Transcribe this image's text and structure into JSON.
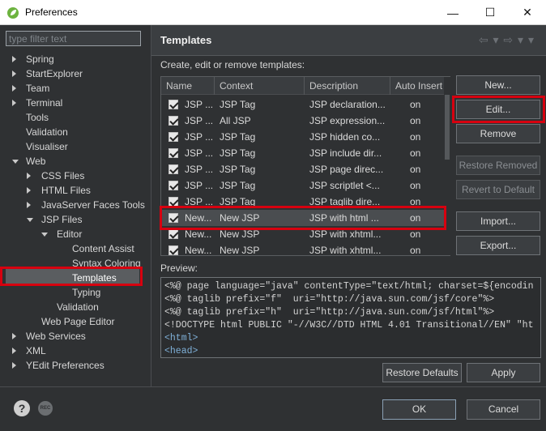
{
  "window": {
    "title": "Preferences",
    "minimize": "—",
    "maximize": "☐",
    "close": "✕"
  },
  "filter": {
    "placeholder": "type filter text"
  },
  "tree": [
    {
      "label": "Spring",
      "expand": "closed"
    },
    {
      "label": "StartExplorer",
      "expand": "closed"
    },
    {
      "label": "Team",
      "expand": "closed"
    },
    {
      "label": "Terminal",
      "expand": "closed"
    },
    {
      "label": "Tools",
      "expand": "none"
    },
    {
      "label": "Validation",
      "expand": "none"
    },
    {
      "label": "Visualiser",
      "expand": "none"
    },
    {
      "label": "Web",
      "expand": "open"
    },
    {
      "label": "CSS Files",
      "expand": "closed"
    },
    {
      "label": "HTML Files",
      "expand": "closed"
    },
    {
      "label": "JavaServer Faces Tools",
      "expand": "closed"
    },
    {
      "label": "JSP Files",
      "expand": "open"
    },
    {
      "label": "Editor",
      "expand": "open"
    },
    {
      "label": "Content Assist",
      "expand": "none"
    },
    {
      "label": "Syntax Coloring",
      "expand": "none"
    },
    {
      "label": "Templates",
      "expand": "none",
      "selected": true
    },
    {
      "label": "Typing",
      "expand": "none"
    },
    {
      "label": "Validation",
      "expand": "none"
    },
    {
      "label": "Web Page Editor",
      "expand": "none"
    },
    {
      "label": "Web Services",
      "expand": "closed"
    },
    {
      "label": "XML",
      "expand": "closed"
    },
    {
      "label": "YEdit Preferences",
      "expand": "closed"
    }
  ],
  "page": {
    "title": "Templates",
    "description": "Create, edit or remove templates:",
    "nav_arrows": "⇦ ▾ ⇨ ▾ ▾"
  },
  "table": {
    "columns": [
      "Name",
      "Context",
      "Description",
      "Auto Insert"
    ],
    "rows": [
      {
        "name": "JSP ...",
        "context": "JSP Tag",
        "description": "JSP declaration...",
        "auto": "on"
      },
      {
        "name": "JSP ...",
        "context": "All JSP",
        "description": "JSP expression...",
        "auto": "on"
      },
      {
        "name": "JSP ...",
        "context": "JSP Tag",
        "description": "JSP hidden co...",
        "auto": "on"
      },
      {
        "name": "JSP ...",
        "context": "JSP Tag",
        "description": "JSP include dir...",
        "auto": "on"
      },
      {
        "name": "JSP ...",
        "context": "JSP Tag",
        "description": "JSP page direc...",
        "auto": "on"
      },
      {
        "name": "JSP ...",
        "context": "JSP Tag",
        "description": "JSP scriptlet <...",
        "auto": "on"
      },
      {
        "name": "JSP ...",
        "context": "JSP Tag",
        "description": "JSP taglib dire...",
        "auto": "on"
      },
      {
        "name": "New...",
        "context": "New JSP",
        "description": "JSP with html ...",
        "auto": "on",
        "selected": true
      },
      {
        "name": "New...",
        "context": "New JSP",
        "description": "JSP with xhtml...",
        "auto": "on"
      },
      {
        "name": "New...",
        "context": "New JSP",
        "description": "JSP with xhtml...",
        "auto": "on"
      }
    ]
  },
  "buttons": {
    "new": "New...",
    "edit": "Edit...",
    "remove": "Remove",
    "restore_removed": "Restore Removed",
    "revert_default": "Revert to Default",
    "import": "Import...",
    "export": "Export...",
    "restore_defaults": "Restore Defaults",
    "apply": "Apply",
    "ok": "OK",
    "cancel": "Cancel"
  },
  "preview": {
    "label": "Preview:",
    "lines": [
      "<%@ page language=\"java\" contentType=\"text/html; charset=${encodin",
      "<%@ taglib prefix=\"f\"  uri=\"http://java.sun.com/jsf/core\"%>",
      "<%@ taglib prefix=\"h\"  uri=\"http://java.sun.com/jsf/html\"%>",
      "<!DOCTYPE html PUBLIC \"-//W3C//DTD HTML 4.01 Transitional//EN\" \"ht",
      "<html>",
      "<head>"
    ]
  },
  "footer": {
    "help": "?",
    "rec": "REC"
  },
  "colors": {
    "highlight": "#d7000f",
    "background": "#2f3133"
  }
}
